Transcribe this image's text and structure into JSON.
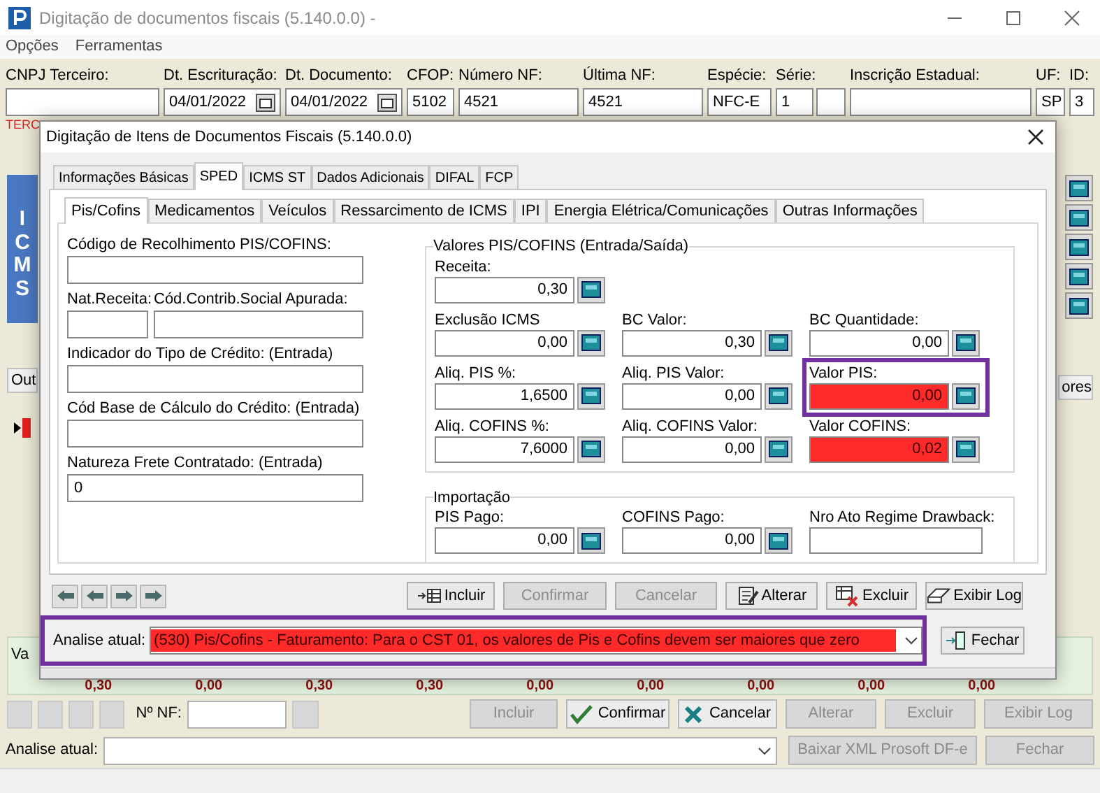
{
  "window": {
    "title": "Digitação de documentos fiscais (5.140.0.0) -"
  },
  "menu": [
    "Opções",
    "Ferramentas"
  ],
  "header_fields": [
    {
      "label": "CNPJ Terceiro:",
      "kind": "text"
    },
    {
      "label": "Dt. Escrituração:",
      "value": "04/01/2022",
      "kind": "date"
    },
    {
      "label": "Dt. Documento:",
      "value": "04/01/2022",
      "kind": "date"
    },
    {
      "label": "CFOP:",
      "value": "5102",
      "kind": "text"
    },
    {
      "label": "Número NF:",
      "value": "4521",
      "kind": "text"
    },
    {
      "label": "Última NF:",
      "value": "4521",
      "kind": "text"
    },
    {
      "label": "Espécie:",
      "value": "NFC-E",
      "kind": "text"
    },
    {
      "label": "Série:",
      "value": "1",
      "kind": "split"
    },
    {
      "label": "Inscrição Estadual:",
      "kind": "text"
    },
    {
      "label": "UF:",
      "value": "SP",
      "kind": "text"
    },
    {
      "label": "ID:",
      "value": "3",
      "kind": "text"
    }
  ],
  "warning": "TERC",
  "side_panel": "ICMS",
  "lower_tabs": [
    "Out",
    "ores"
  ],
  "totals": {
    "label": "Va",
    "values": [
      "0,30",
      "0,00",
      "0,30",
      "0,30",
      "0,00",
      "0,00",
      "0,00",
      "0,00",
      "0,00"
    ]
  },
  "nf_field": {
    "label": "Nº NF:"
  },
  "toolbar_buttons": [
    {
      "label": "Incluir",
      "disabled": true
    },
    {
      "label": "Confirmar",
      "disabled": false
    },
    {
      "label": "Cancelar",
      "disabled": false
    },
    {
      "label": "Alterar",
      "disabled": true
    },
    {
      "label": "Excluir",
      "disabled": true
    },
    {
      "label": "Exibir Log",
      "disabled": true
    }
  ],
  "analysis": {
    "label": "Analise atual:"
  },
  "bottom_buttons": [
    {
      "label": "Baixar XML Prosoft DF-e",
      "disabled": true
    },
    {
      "label": "Fechar",
      "disabled": true
    }
  ],
  "dialog": {
    "title": "Digitação de Itens de Documentos Fiscais (5.140.0.0)",
    "tabs": [
      {
        "label": "Informações Básicas",
        "selected": false
      },
      {
        "label": "SPED",
        "selected": true
      },
      {
        "label": "ICMS ST",
        "selected": false
      },
      {
        "label": "Dados Adicionais",
        "selected": false
      },
      {
        "label": "DIFAL",
        "selected": false
      },
      {
        "label": "FCP",
        "selected": false
      }
    ],
    "subtabs": [
      {
        "label": "Pis/Cofins",
        "selected": true
      },
      {
        "label": "Medicamentos",
        "selected": false
      },
      {
        "label": "Veículos",
        "selected": false
      },
      {
        "label": "Ressarcimento de ICMS",
        "selected": false
      },
      {
        "label": "IPI",
        "selected": false
      },
      {
        "label": "Energia Elétrica/Comunicações",
        "selected": false
      },
      {
        "label": "Outras Informações",
        "selected": false
      }
    ],
    "left_fields": [
      [
        {
          "label": "Código de Recolhimento PIS/COFINS:"
        }
      ],
      [
        {
          "label": "Nat.Receita:"
        },
        {
          "label": "Cód.Contrib.Social Apurada:"
        }
      ],
      [
        {
          "label": "Indicador do Tipo de Crédito: (Entrada)"
        }
      ],
      [
        {
          "label": "Cód Base de Cálculo do Crédito: (Entrada)"
        }
      ],
      [
        {
          "label": "Natureza Frete Contratado: (Entrada)",
          "value": "0"
        }
      ]
    ],
    "groups": [
      {
        "title": "Valores PIS/COFINS (Entrada/Saída)",
        "rows": [
          [
            {
              "label": "Receita:",
              "value": "0,30",
              "kind": "calc",
              "error": false,
              "highlighted": false
            }
          ],
          [
            {
              "label": "Exclusão ICMS",
              "value": "0,00",
              "kind": "calc",
              "error": false,
              "highlighted": false
            },
            {
              "label": "BC Valor:",
              "value": "0,30",
              "kind": "calc",
              "error": false,
              "highlighted": false
            },
            {
              "label": "BC Quantidade:",
              "value": "0,00",
              "kind": "calc",
              "error": false,
              "highlighted": false
            }
          ],
          [
            {
              "label": "Aliq. PIS %:",
              "value": "1,6500",
              "kind": "calc",
              "error": false,
              "highlighted": false
            },
            {
              "label": "Aliq. PIS Valor:",
              "value": "0,00",
              "kind": "calc",
              "error": false,
              "highlighted": false
            },
            {
              "label": "Valor PIS:",
              "value": "0,00",
              "kind": "calc",
              "error": true,
              "highlighted": true
            }
          ],
          [
            {
              "label": "Aliq. COFINS %:",
              "value": "7,6000",
              "kind": "calc",
              "error": false,
              "highlighted": false
            },
            {
              "label": "Aliq. COFINS Valor:",
              "value": "0,00",
              "kind": "calc",
              "error": false,
              "highlighted": false
            },
            {
              "label": "Valor COFINS:",
              "value": "0,02",
              "kind": "calc",
              "error": true,
              "highlighted": false
            }
          ]
        ]
      },
      {
        "title": "Importação",
        "rows": [
          [
            {
              "label": "PIS Pago:",
              "value": "0,00",
              "kind": "calc",
              "error": false,
              "highlighted": false
            },
            {
              "label": "COFINS Pago:",
              "value": "0,00",
              "kind": "calc",
              "error": false,
              "highlighted": false
            },
            {
              "label": "Nro Ato Regime Drawback:",
              "kind": "text",
              "error": false,
              "highlighted": false
            }
          ]
        ]
      }
    ],
    "buttons": [
      {
        "label": "Incluir",
        "disabled": false
      },
      {
        "label": "Confirmar",
        "disabled": true
      },
      {
        "label": "Cancelar",
        "disabled": true
      },
      {
        "label": "Alterar",
        "disabled": false
      },
      {
        "label": "Excluir",
        "disabled": false
      },
      {
        "label": "Exibir Log",
        "disabled": false
      }
    ],
    "analysis": {
      "label": "Analise atual:",
      "value": "(530) Pis/Cofins - Faturamento: Para o CST 01, os valores de Pis e Cofins devem ser maiores que zero",
      "error": true,
      "highlighted": true
    },
    "close_button": {
      "label": "Fechar",
      "disabled": false
    }
  }
}
